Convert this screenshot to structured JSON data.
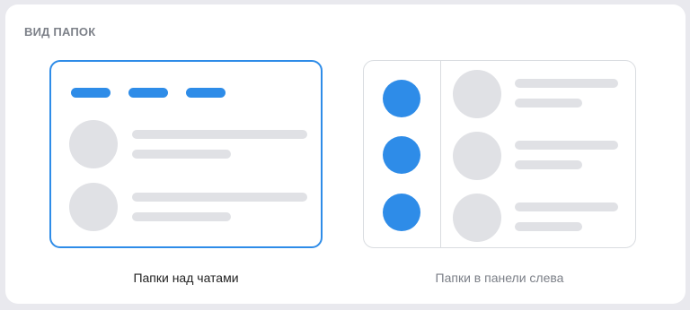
{
  "section": {
    "title": "ВИД ПАПОК"
  },
  "options": [
    {
      "id": "top",
      "label": "Папки над чатами",
      "selected": true
    },
    {
      "id": "left",
      "label": "Папки в панели слева",
      "selected": false
    }
  ],
  "colors": {
    "accent": "#2e8ce8",
    "placeholder": "#e0e1e5",
    "border": "#d9dce0",
    "background": "#e9e9ee"
  }
}
